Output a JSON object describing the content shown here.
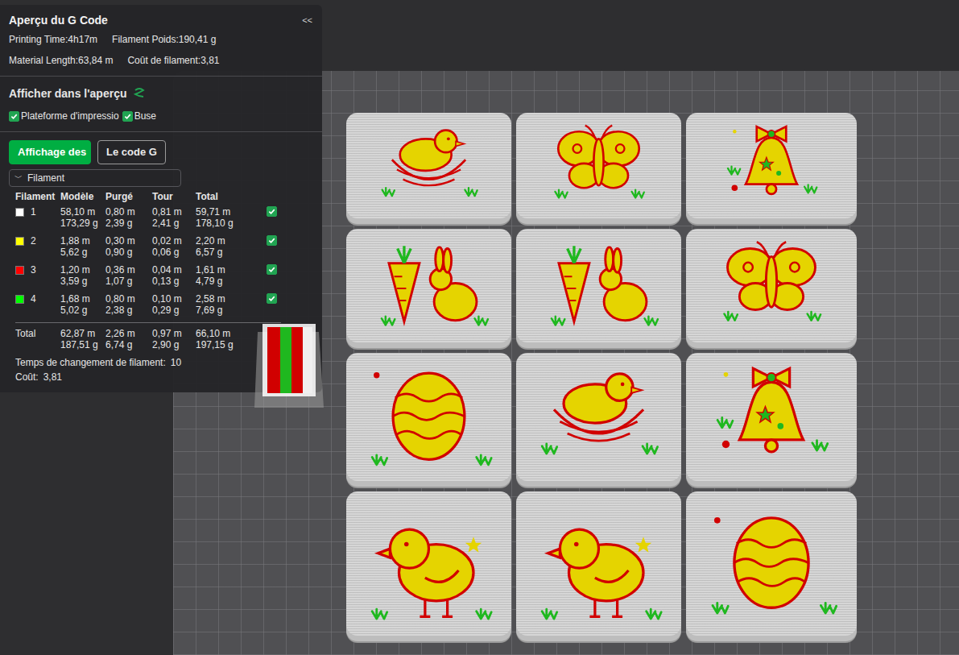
{
  "panel": {
    "title": "Aperçu du G Code",
    "collapse": "<<",
    "stats": [
      [
        {
          "label": "Printing Time:",
          "value": "4h17m"
        },
        {
          "label": "Filament Poids:",
          "value": "190,41 g"
        }
      ],
      [
        {
          "label": "Material Length:",
          "value": "63,84 m"
        },
        {
          "label": "Coût de filament:",
          "value": "3,81"
        }
      ]
    ]
  },
  "show_in_preview": {
    "label": "Afficher dans l'aperçu",
    "options": [
      {
        "label": "Plateforme d'impressio",
        "checked": true
      },
      {
        "label": "Buse",
        "checked": true
      }
    ]
  },
  "tabs": [
    {
      "label": "Affichage des",
      "selected": true
    },
    {
      "label": "Le code G",
      "selected": false
    }
  ],
  "dropdown": {
    "label": "Filament",
    "chevron": "﹀",
    "expanded": true
  },
  "table": {
    "columns": [
      "Filament",
      "Modèle",
      "Purgé",
      "Tour",
      "Total"
    ],
    "rows": [
      {
        "id": "1",
        "color": "#ffffff",
        "model": [
          "58,10 m",
          "173,29 g"
        ],
        "purged": [
          "0,80 m",
          "2,39 g"
        ],
        "tower": [
          "0,81 m",
          "2,41 g"
        ],
        "total": [
          "59,71 m",
          "178,10 g"
        ],
        "checked": true
      },
      {
        "id": "2",
        "color": "#ffff00",
        "model": [
          "1,88 m",
          "5,62 g"
        ],
        "purged": [
          "0,30 m",
          "0,90 g"
        ],
        "tower": [
          "0,02 m",
          "0,06 g"
        ],
        "total": [
          "2,20 m",
          "6,57 g"
        ],
        "checked": true
      },
      {
        "id": "3",
        "color": "#ff0000",
        "model": [
          "1,20 m",
          "3,59 g"
        ],
        "purged": [
          "0,36 m",
          "1,07 g"
        ],
        "tower": [
          "0,04 m",
          "0,13 g"
        ],
        "total": [
          "1,61 m",
          "4,79 g"
        ],
        "checked": true
      },
      {
        "id": "4",
        "color": "#00ff00",
        "model": [
          "1,68 m",
          "5,02 g"
        ],
        "purged": [
          "0,80 m",
          "2,38 g"
        ],
        "tower": [
          "0,10 m",
          "0,29 g"
        ],
        "total": [
          "2,58 m",
          "7,69 g"
        ],
        "checked": true
      }
    ],
    "total_row": {
      "label": "Total",
      "model": [
        "62,87 m",
        "187,51 g"
      ],
      "purged": [
        "2,26 m",
        "6,74 g"
      ],
      "tower": [
        "0,97 m",
        "2,90 g"
      ],
      "total": [
        "66,10 m",
        "197,15 g"
      ]
    }
  },
  "filament_changes": {
    "label": "Temps de changement de filament:",
    "value": "10"
  },
  "cost": {
    "label": "Coût:",
    "value": "3,81"
  },
  "plate": {
    "tiles": [
      {
        "kind": "chick-nest"
      },
      {
        "kind": "butterfly"
      },
      {
        "kind": "bell"
      },
      {
        "kind": "carrot-bunny"
      },
      {
        "kind": "carrot-bunny"
      },
      {
        "kind": "butterfly"
      },
      {
        "kind": "egg"
      },
      {
        "kind": "chick-nest"
      },
      {
        "kind": "bell"
      },
      {
        "kind": "chick"
      },
      {
        "kind": "chick"
      },
      {
        "kind": "egg"
      }
    ]
  }
}
